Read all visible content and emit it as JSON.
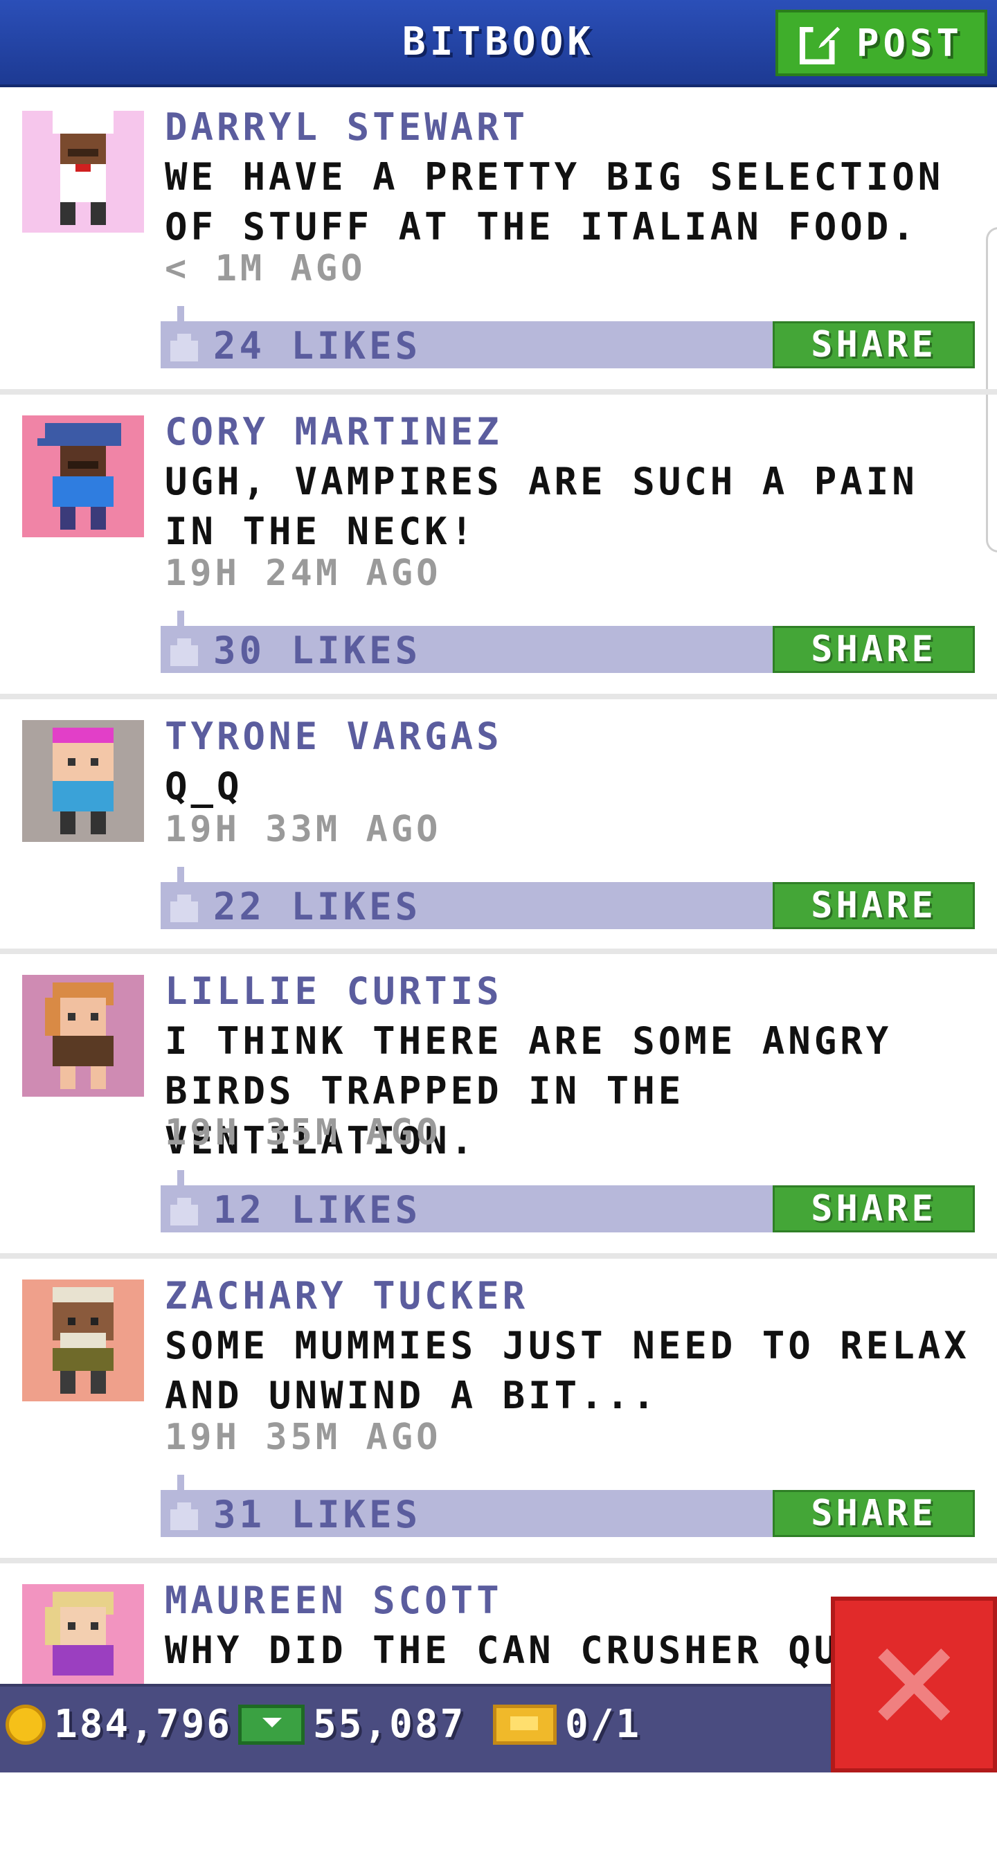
{
  "header": {
    "title": "BITBOOK",
    "post_label": "POST"
  },
  "posts": [
    {
      "name": "DARRYL STEWART",
      "message": "WE HAVE A PRETTY BIG SELECTION OF STUFF AT THE ITALIAN FOOD.",
      "time": "< 1M AGO",
      "likes": "24 LIKES",
      "share": "SHARE",
      "avatar_bg": "#f6c6ec"
    },
    {
      "name": "CORY MARTINEZ",
      "message": "UGH, VAMPIRES ARE SUCH A PAIN IN THE NECK!",
      "time": "19H 24M AGO",
      "likes": "30 LIKES",
      "share": "SHARE",
      "avatar_bg": "#f084a6"
    },
    {
      "name": "TYRONE VARGAS",
      "message": "Q_Q",
      "time": "19H 33M AGO",
      "likes": "22 LIKES",
      "share": "SHARE",
      "avatar_bg": "#aca39f"
    },
    {
      "name": "LILLIE CURTIS",
      "message": "I THINK THERE ARE SOME ANGRY BIRDS TRAPPED IN THE VENTILATION.",
      "time": "19H 35M AGO",
      "likes": "12 LIKES",
      "share": "SHARE",
      "avatar_bg": "#cf8bb3"
    },
    {
      "name": "ZACHARY TUCKER",
      "message": "SOME MUMMIES JUST NEED TO RELAX AND UNWIND A BIT...",
      "time": "19H 35M AGO",
      "likes": "31 LIKES",
      "share": "SHARE",
      "avatar_bg": "#efa08b"
    },
    {
      "name": "MAUREEN SCOTT",
      "message": "WHY DID THE CAN CRUSHER QUIT",
      "time": "",
      "likes": "",
      "share": "",
      "avatar_bg": "#f294c0"
    }
  ],
  "bottom_bar": {
    "coins": "184,796",
    "bux": "55,087",
    "tickets": "0/1"
  },
  "colors": {
    "header": "#2b4fb8",
    "green": "#44a637",
    "like_bar": "#b7b8da",
    "close": "#e12a2a"
  }
}
